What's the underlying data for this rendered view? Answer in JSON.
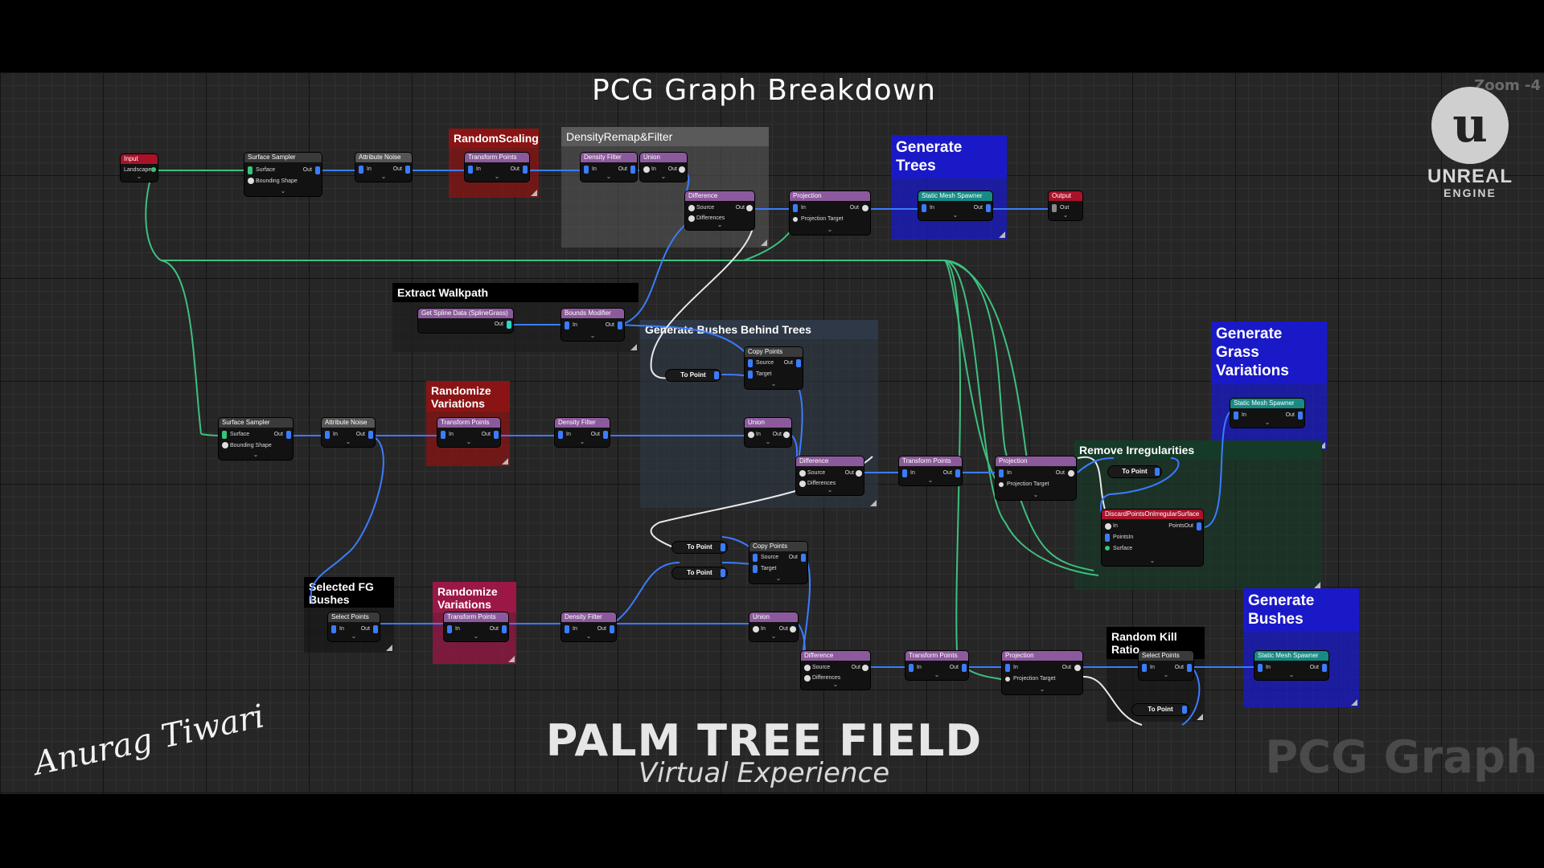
{
  "header": {
    "title": "PCG Graph Breakdown",
    "zoom": "Zoom -4"
  },
  "logo": {
    "glyph": "u",
    "word1": "UNREAL",
    "word2": "ENGINE"
  },
  "footer": {
    "brand_main": "PALM TREE FIELD",
    "brand_sub": "Virtual Experience",
    "signature": "Anurag Tiwari",
    "watermark": "PCG Graph"
  },
  "colors": {
    "wire_blue": "#3b7cff",
    "wire_green": "#3fbf7f",
    "wire_white": "#e8e8e8",
    "comment_red": "#8a1414",
    "comment_blue": "#1a19c8",
    "comment_pink": "#9a1746",
    "comment_gray": "#4a4a4a",
    "comment_slate": "#2f3a48",
    "comment_green": "#163a28"
  },
  "comments": {
    "random_scaling": "RandomScaling",
    "density_remap": "DensityRemap&Filter",
    "generate_trees": "Generate\nTrees",
    "extract_walkpath": "Extract Walkpath",
    "bushes_behind_trees": "Generate Bushes Behind Trees",
    "randomize_variations_1": "Randomize\nVariations",
    "generate_grass": "Generate\nGrass\nVariations",
    "remove_irregularities": "Remove Irregularities",
    "selected_fg_bushes": "Selected FG\nBushes",
    "randomize_variations_2": "Randomize\nVariations",
    "random_kill_ratio": "Random Kill Ratio",
    "generate_bushes": "Generate\nBushes"
  },
  "nodes": {
    "input": "Input",
    "landscape": "Landscape",
    "surface_sampler_1": "Surface Sampler",
    "attribute_noise_1": "Attribute Noise",
    "transform_points_1": "Transform Points",
    "density_filter_1": "Density Filter",
    "union_1": "Union",
    "difference_1": "Difference",
    "projection_1": "Projection",
    "static_mesh_spawner_1": "Static Mesh Spawner",
    "output": "Output",
    "get_spline_data": "Get Spline Data (SplineGrass)",
    "bounds_modifier": "Bounds Modifier",
    "copy_points_1": "Copy Points",
    "to_point_1": "To Point",
    "surface_sampler_2": "Surface Sampler",
    "attribute_noise_2": "Attribute Noise",
    "transform_points_2": "Transform Points",
    "density_filter_2": "Density Filter",
    "union_2": "Union",
    "difference_2": "Difference",
    "transform_points_3": "Transform Points",
    "projection_2": "Projection",
    "static_mesh_spawner_2": "Static Mesh Spawner",
    "to_point_2": "To Point",
    "discard_points": "DiscardPointsOnIrregularSurface",
    "to_point_3": "To Point",
    "to_point_4": "To Point",
    "copy_points_2": "Copy Points",
    "select_points_1": "Select Points",
    "transform_points_4": "Transform Points",
    "density_filter_3": "Density Filter",
    "union_3": "Union",
    "difference_3": "Difference",
    "transform_points_5": "Transform Points",
    "projection_3": "Projection",
    "select_points_2": "Select Points",
    "to_point_5": "To Point",
    "static_mesh_spawner_3": "Static Mesh Spawner"
  },
  "pins": {
    "in": "In",
    "out": "Out",
    "surface": "Surface",
    "bounding_shape": "Bounding Shape",
    "source": "Source",
    "target": "Target",
    "differences": "Differences",
    "projection_target": "Projection Target",
    "points_in": "PointsIn",
    "points_out": "PointsOut"
  }
}
